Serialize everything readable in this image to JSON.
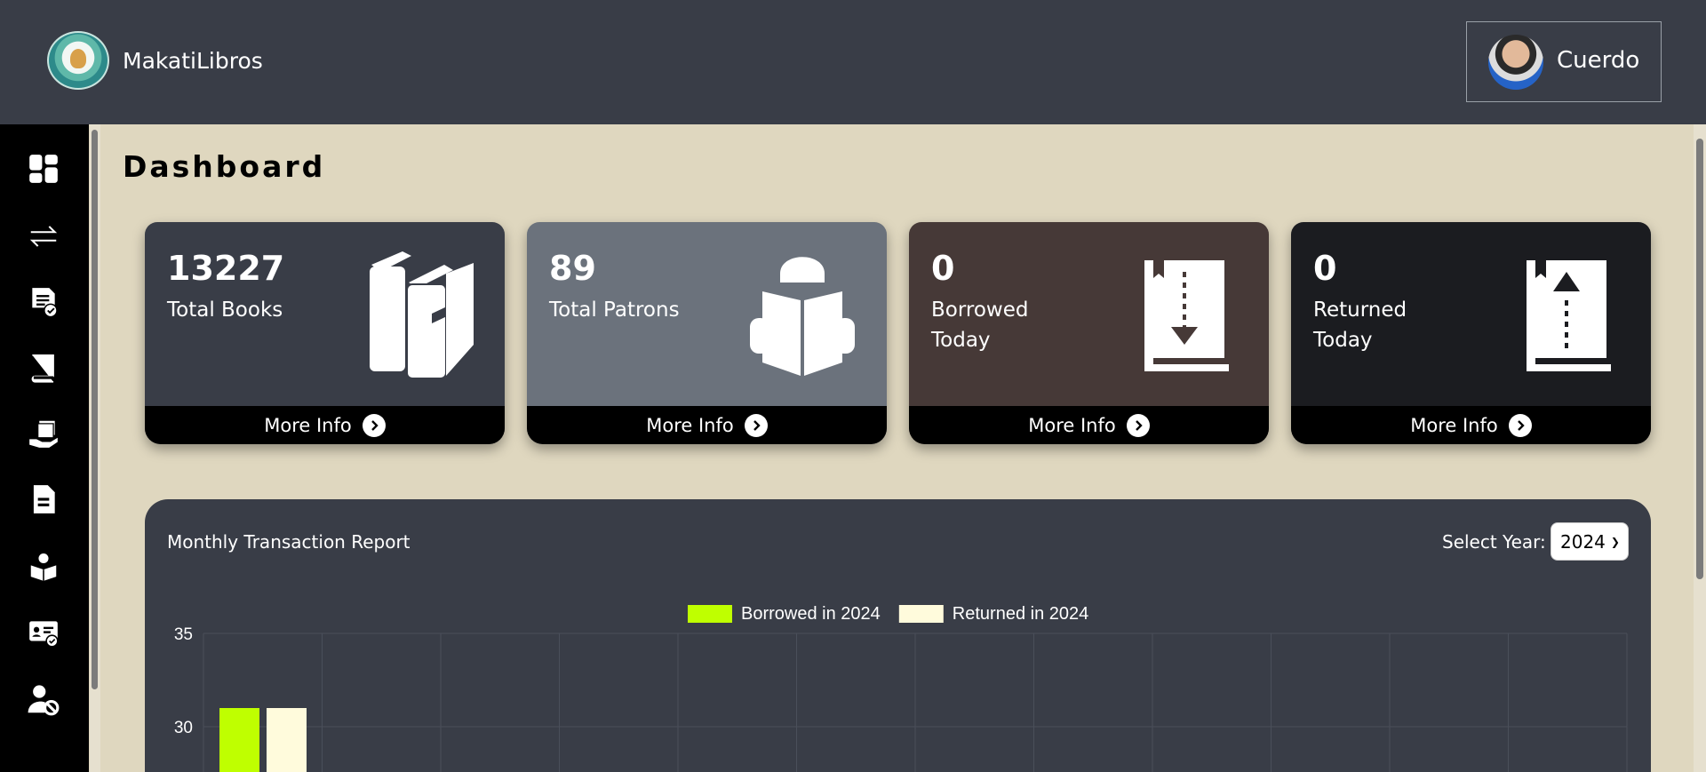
{
  "header": {
    "brand": "MakatiLibros",
    "user_name": "Cuerdo"
  },
  "sidebar": {
    "items": [
      {
        "icon": "dashboard-icon"
      },
      {
        "icon": "transactions-icon"
      },
      {
        "icon": "checked-document-icon"
      },
      {
        "icon": "book-icon"
      },
      {
        "icon": "hand-book-icon"
      },
      {
        "icon": "document-icon"
      },
      {
        "icon": "patron-reading-icon"
      },
      {
        "icon": "id-card-icon"
      },
      {
        "icon": "user-block-icon"
      }
    ]
  },
  "page": {
    "title": "Dashboard"
  },
  "cards": [
    {
      "value": "13227",
      "label": "Total Books",
      "more": "More Info",
      "color": "#393d47",
      "icon": "books-icon"
    },
    {
      "value": "89",
      "label": "Total Patrons",
      "more": "More Info",
      "color": "#6b727c",
      "icon": "reader-icon"
    },
    {
      "value": "0",
      "label": "Borrowed Today",
      "more": "More Info",
      "color": "#463937",
      "icon": "book-download-icon"
    },
    {
      "value": "0",
      "label": "Returned Today",
      "more": "More Info",
      "color": "#1b1c20",
      "icon": "book-upload-icon"
    }
  ],
  "report": {
    "title": "Monthly Transaction Report",
    "year_label": "Select Year:",
    "year_value": "2024"
  },
  "chart_data": {
    "type": "bar",
    "categories": [
      "",
      "",
      "",
      "",
      "",
      "",
      "",
      "",
      "",
      "",
      "",
      ""
    ],
    "series": [
      {
        "name": "Borrowed in 2024",
        "values": [
          31,
          null,
          null,
          null,
          null,
          null,
          null,
          null,
          null,
          null,
          null,
          null
        ],
        "color": "#bfff00"
      },
      {
        "name": "Returned in 2024",
        "values": [
          31,
          null,
          null,
          null,
          null,
          null,
          null,
          null,
          null,
          null,
          null,
          null
        ],
        "color": "#fffbdc"
      }
    ],
    "yticks": [
      35,
      30
    ],
    "ylim": [
      0,
      35
    ],
    "grid": true,
    "legend": "top-center"
  }
}
